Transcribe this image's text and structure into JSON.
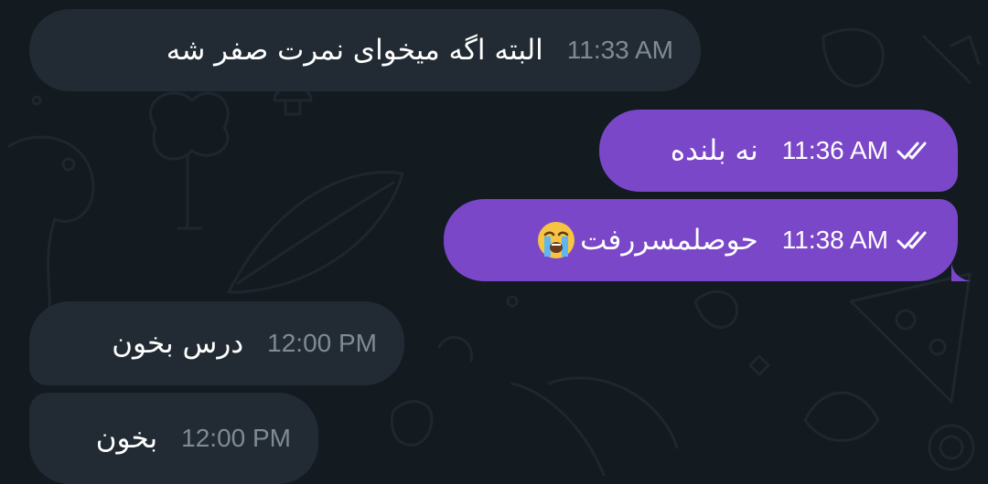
{
  "theme": {
    "background": "#131b21",
    "incoming_bubble": "#222b33",
    "outgoing_bubble": "#7a47c9",
    "incoming_time_color": "#7f8b94",
    "outgoing_time_color": "#ffffff"
  },
  "messages": [
    {
      "direction": "incoming",
      "text": "البته اگه میخوای نمرت صفر شه",
      "time": "11:33 AM"
    },
    {
      "direction": "outgoing",
      "text": "نه بلنده",
      "time": "11:36 AM",
      "status_icon": "double-check-icon"
    },
    {
      "direction": "outgoing",
      "text": "حوصلمسررفت",
      "emoji": "loudly-crying-face-icon",
      "time": "11:38 AM",
      "status_icon": "double-check-icon"
    },
    {
      "direction": "incoming",
      "text": "درس بخون",
      "time": "12:00 PM"
    },
    {
      "direction": "incoming",
      "text": "بخون",
      "time": "12:00 PM"
    }
  ]
}
